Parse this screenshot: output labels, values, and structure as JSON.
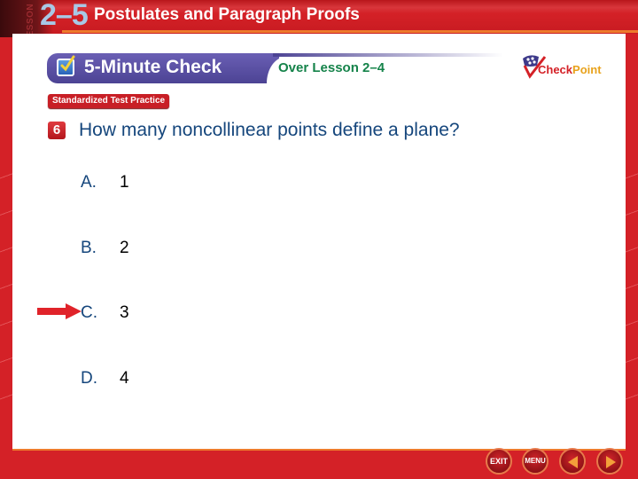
{
  "header": {
    "lesson_tag": "LESSON",
    "lesson_number": "2–5",
    "lesson_title": "Postulates and Paragraph Proofs"
  },
  "banner": {
    "icon": "checkbox-check-icon",
    "title": "5-Minute Check",
    "over_lesson": "Over Lesson 2–4"
  },
  "logo": {
    "check": "Check",
    "point": "Point"
  },
  "badge": "Standardized Test Practice",
  "question": {
    "number": "6",
    "text": "How many noncollinear points define a plane?"
  },
  "options": [
    {
      "letter": "A.",
      "value": "1",
      "selected": false
    },
    {
      "letter": "B.",
      "value": "2",
      "selected": false
    },
    {
      "letter": "C.",
      "value": "3",
      "selected": true
    },
    {
      "letter": "D.",
      "value": "4",
      "selected": false
    }
  ],
  "navigation": {
    "exit": "EXIT",
    "menu": "MENU",
    "previous": "previous-arrow-icon",
    "next": "next-arrow-icon"
  },
  "colors": {
    "brand_red": "#d42127",
    "banner_purple": "#4c4394",
    "question_blue": "#15467c",
    "lesson_green": "#15834a",
    "accent_orange": "#ee7b2c"
  }
}
